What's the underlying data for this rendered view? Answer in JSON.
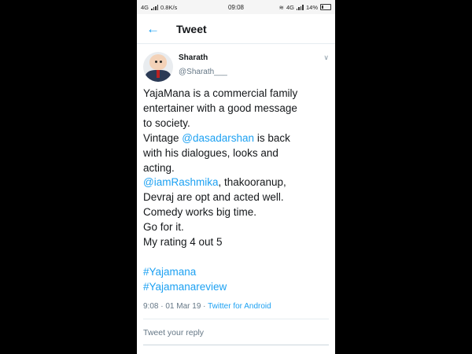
{
  "status_bar": {
    "network": "4G",
    "speed": "0.8K/s",
    "time": "09:08",
    "network_right": "4G",
    "battery": "14%"
  },
  "header": {
    "title": "Tweet"
  },
  "tweet": {
    "name": "Sharath",
    "handle": "@Sharath___",
    "lines": {
      "l1": "YajaMana is a commercial family",
      "l2": "entertainer with a good message",
      "l3": "to society.",
      "l4_pre": "Vintage ",
      "l4_link": "@dasadarshan",
      "l4_post": " is back",
      "l5": "with his dialogues, looks and",
      "l6": "acting.",
      "l7_link": "@iamRashmika",
      "l7_post": ", thakooranup,",
      "l8": "Devraj are opt and acted well.",
      "l9": "Comedy works big time.",
      "l10": "Go for it.",
      "l11": "My rating 4 out 5",
      "hashtag1": "#Yajamana",
      "hashtag2": "#Yajamanareview"
    },
    "meta_time": "9:08 · 01 Mar 19 · ",
    "meta_source": "Twitter for Android"
  },
  "reply": {
    "placeholder": "Tweet your reply"
  },
  "colors": {
    "link": "#1da1f2",
    "text": "#14171a",
    "muted": "#657786"
  }
}
